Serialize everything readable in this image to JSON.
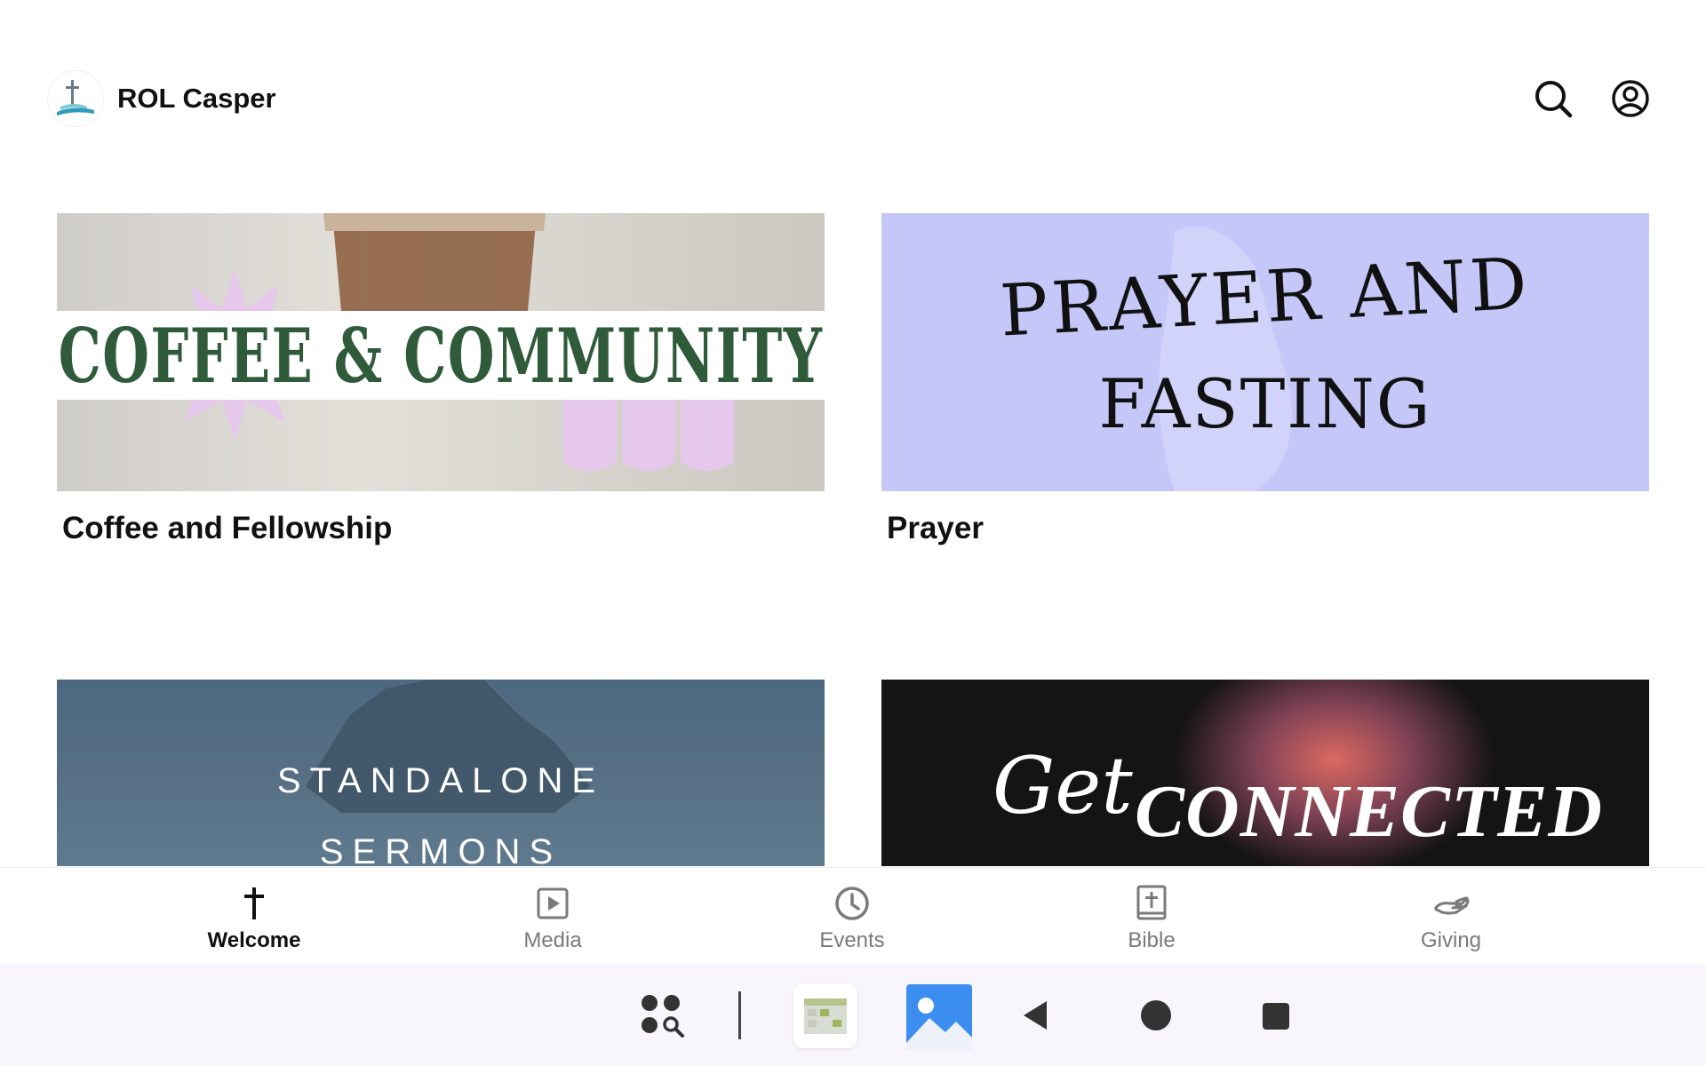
{
  "header": {
    "app_title": "ROL Casper"
  },
  "cards": [
    {
      "banner_text": "COFFEE & COMMUNITY",
      "caption": "Coffee and Fellowship"
    },
    {
      "banner_line1": "PRAYER AND",
      "banner_line2": "FASTING",
      "caption": "Prayer"
    },
    {
      "banner_line1": "STANDALONE",
      "banner_line2": "SERMONS"
    },
    {
      "banner_script": "Get",
      "banner_word": "CONNECTED"
    }
  ],
  "tabs": [
    {
      "label": "Welcome",
      "icon": "cross-icon",
      "active": true
    },
    {
      "label": "Media",
      "icon": "play-square-icon"
    },
    {
      "label": "Events",
      "icon": "clock-icon"
    },
    {
      "label": "Bible",
      "icon": "bible-icon"
    },
    {
      "label": "Giving",
      "icon": "giving-hand-icon"
    }
  ],
  "system_nav": [
    "app-drawer-search-icon",
    "calendar-app-icon",
    "gallery-app-icon",
    "back-icon",
    "home-icon",
    "recents-icon"
  ],
  "colors": {
    "accent_text": "#111111",
    "inactive_tab": "#7a7a7a",
    "coffee_green": "#2f5b3a",
    "prayer_lavender": "#c5c7f8"
  }
}
